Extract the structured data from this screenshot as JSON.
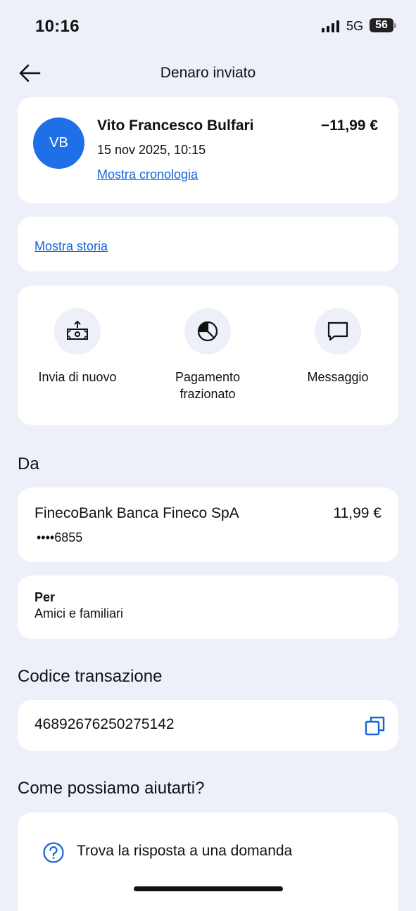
{
  "status_bar": {
    "time": "10:16",
    "network": "5G",
    "battery": "56"
  },
  "header": {
    "title": "Denaro inviato"
  },
  "transaction": {
    "initials": "VB",
    "name": "Vito Francesco Bulfari",
    "amount": "−11,99 €",
    "date": "15 nov 2025, 10:15",
    "history_link": "Mostra cronologia"
  },
  "story": {
    "link": "Mostra storia"
  },
  "actions": [
    {
      "label": "Invia di nuovo",
      "icon": "send-money-icon"
    },
    {
      "label": "Pagamento frazionato",
      "icon": "pie-chart-icon"
    },
    {
      "label": "Messaggio",
      "icon": "message-icon"
    }
  ],
  "from": {
    "heading": "Da",
    "bank": "FinecoBank Banca Fineco SpA",
    "amount": "11,99 €",
    "account": "••••6855"
  },
  "for": {
    "label": "Per",
    "value": "Amici e familiari"
  },
  "transaction_code": {
    "heading": "Codice transazione",
    "value": "46892676250275142",
    "copy_icon": "copy-icon"
  },
  "help": {
    "heading": "Come possiamo aiutarti?",
    "item": "Trova la risposta a una domanda",
    "icon": "help-circle-icon"
  },
  "colors": {
    "accent": "#1565d8",
    "avatar": "#1f6fe9",
    "background": "#eef0f9"
  }
}
